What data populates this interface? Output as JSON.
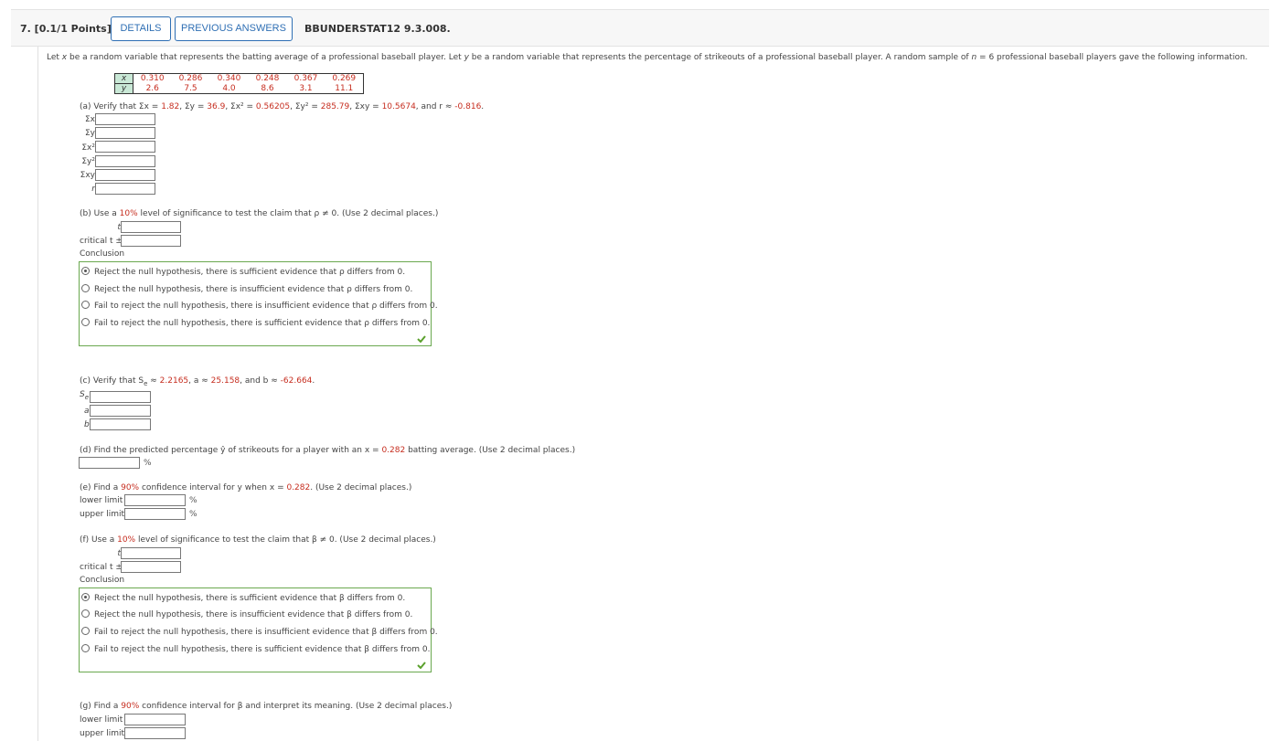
{
  "header": {
    "question_number": "7.  [0.1/1 Points]",
    "details_label": "DETAILS",
    "previous_answers_label": "PREVIOUS ANSWERS",
    "code": "BBUNDERSTAT12 9.3.008."
  },
  "intro": {
    "p1": "Let ",
    "x": "x",
    "p2": " be a random variable that represents the batting average of a professional baseball player. Let ",
    "y": "y",
    "p3": " be a random variable that represents the percentage of strikeouts of a professional baseball player. A random sample of ",
    "n": "n",
    "p4": " = 6 professional baseball players gave the following information."
  },
  "table": {
    "x_label": "x",
    "y_label": "y",
    "x_values": [
      "0.310",
      "0.286",
      "0.340",
      "0.248",
      "0.367",
      "0.269"
    ],
    "y_values": [
      "2.6",
      "7.5",
      "4.0",
      "8.6",
      "3.1",
      "11.1"
    ]
  },
  "part_a": {
    "p1": "(a) Verify that Σx = ",
    "sx": "1.82",
    "p2": ", Σy = ",
    "sy": "36.9",
    "p3": ", Σx² = ",
    "sx2": "0.56205",
    "p4": ", Σy² = ",
    "sy2": "285.79",
    "p5": ", Σxy = ",
    "sxy": "10.5674",
    "p6": ", and r ≈ ",
    "r": "-0.816",
    "p7": ".",
    "labels": [
      "Σx",
      "Σy",
      "Σx²",
      "Σy²",
      "Σxy",
      "r"
    ]
  },
  "part_b": {
    "p1": "(b) Use a ",
    "level": "10%",
    "p2": " level of significance to test the claim that ρ ≠ 0. (Use 2 decimal places.)",
    "t_label": "t",
    "critical_label": "critical t ±",
    "conclusion_label": "Conclusion",
    "options": [
      "Reject the null hypothesis, there is sufficient evidence that ρ differs from 0.",
      "Reject the null hypothesis, there is insufficient evidence that ρ differs from 0.",
      "Fail to reject the null hypothesis, there is insufficient evidence that ρ differs from 0.",
      "Fail to reject the null hypothesis, there is sufficient evidence that ρ differs from 0."
    ],
    "selected": 0
  },
  "part_c": {
    "p1": "(c) Verify that S",
    "sub": "e",
    "p2": " ≈ ",
    "se": "2.2165",
    "p3": ", a ≈ ",
    "a": "25.158",
    "p4": ", and b ≈ ",
    "b": "-62.664",
    "p5": ".",
    "label_se": "S",
    "label_se_sub": "e",
    "label_a": "a",
    "label_b": "b"
  },
  "part_d": {
    "p1": "(d) Find the predicted percentage ŷ of strikeouts for a player with an x = ",
    "x": "0.282",
    "p2": " batting average. (Use 2 decimal places.)",
    "unit": "%"
  },
  "part_e": {
    "p1": "(e) Find a ",
    "level": "90%",
    "p2": " confidence interval for y when x = ",
    "x": "0.282",
    "p3": ". (Use 2 decimal places.)",
    "lower_label": "lower limit",
    "upper_label": "upper limit",
    "unit": "%"
  },
  "part_f": {
    "p1": "(f) Use a ",
    "level": "10%",
    "p2": " level of significance to test the claim that β ≠ 0. (Use 2 decimal places.)",
    "t_label": "t",
    "critical_label": "critical t ±",
    "conclusion_label": "Conclusion",
    "options": [
      "Reject the null hypothesis, there is sufficient evidence that β differs from 0.",
      "Reject the null hypothesis, there is insufficient evidence that β differs from 0.",
      "Fail to reject the null hypothesis, there is insufficient evidence that β differs from 0.",
      "Fail to reject the null hypothesis, there is sufficient evidence that β differs from 0."
    ],
    "selected": 0
  },
  "part_g": {
    "p1": "(g) Find a ",
    "level": "90%",
    "p2": " confidence interval for β and interpret its meaning. (Use 2 decimal places.)",
    "lower_label": "lower limit",
    "upper_label": "upper limit"
  },
  "colors": {
    "accent": "#2f6fb4",
    "given_value": "#c62d1f",
    "correct_border": "#6aa84f"
  }
}
